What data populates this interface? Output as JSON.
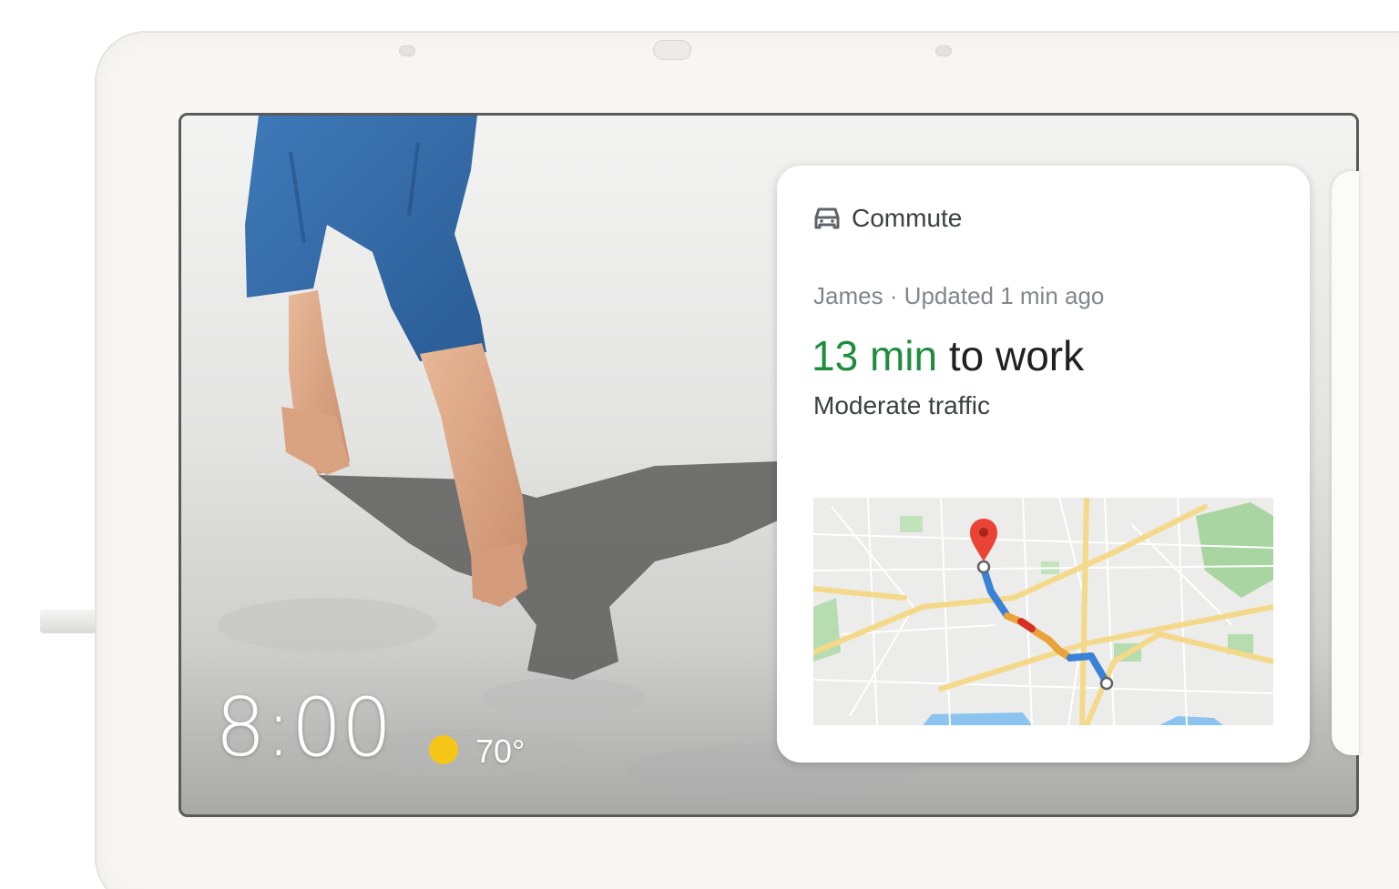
{
  "ambient": {
    "time": "8:00",
    "temperature": "70°"
  },
  "card": {
    "title": "Commute",
    "meta": "James · Updated 1 min ago",
    "eta_time": "13 min",
    "eta_suffix": " to work",
    "traffic": "Moderate traffic"
  },
  "colors": {
    "eta_green": "#1e8e3e",
    "route_blue": "#3b82d6",
    "route_orange": "#e8a33a",
    "route_red": "#d93025",
    "pin_red": "#ea4335",
    "sun_yellow": "#f5c518"
  },
  "icons": {
    "card_icon": "car-icon",
    "weather_icon": "sun-icon",
    "map_pin": "location-pin-icon"
  }
}
